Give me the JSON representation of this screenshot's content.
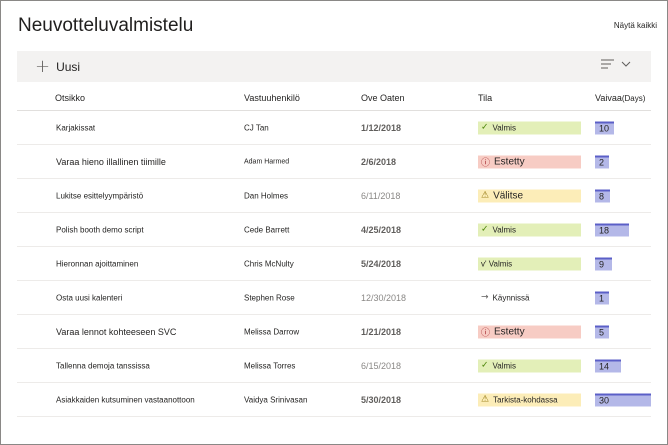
{
  "app": {
    "title": "Neuvotteluvalmistelu",
    "see_all": "Näytä kaikki"
  },
  "toolbar": {
    "new_label": "Uusi",
    "new_icon": "plus-icon",
    "view_icon": "view-options-icon"
  },
  "columns": {
    "title": "Otsikko",
    "owner": "Vastuuhenkilö",
    "due": "Ove Oaten",
    "status": "Tila",
    "effort": "Vaivaa",
    "effort_unit": "(Days)"
  },
  "status_colors": {
    "done": "#e3efb8",
    "blocked": "#f7ccc4",
    "review": "#fcedb8",
    "in_progress": "#ffffff"
  },
  "effort_max_days": 30,
  "rows": [
    {
      "title": "Karjakissat",
      "owner": "CJ Tan",
      "due": "1/12/2018",
      "status": "Valmis",
      "status_icon": "✓",
      "status_kind": "done",
      "effort": "10",
      "effort_days": 10
    },
    {
      "title": "Varaa hieno illallinen tiimille",
      "owner": "Adam Harmed",
      "due": "2/6/2018",
      "status": "Estetty",
      "status_icon": "ⓘ",
      "status_kind": "blocked",
      "effort": "2",
      "effort_days": 2
    },
    {
      "title": "Lukitse esittelyympäristö",
      "owner": "Dan Holmes",
      "due": "6/11/2018",
      "status": "Välitse",
      "status_icon": "⚠",
      "status_kind": "review",
      "effort": "8",
      "effort_days": 8
    },
    {
      "title": "Polish booth demo script",
      "owner": "Cede Barrett",
      "due": "4/25/2018",
      "status": "Valmis",
      "status_icon": "✓",
      "status_kind": "done",
      "effort": "18",
      "effort_days": 18
    },
    {
      "title": "Hieronnan ajoittaminen",
      "owner": "Chris McNulty",
      "due": "5/24/2018",
      "status": "v' Valmis",
      "status_icon": "",
      "status_kind": "done",
      "effort": "9",
      "effort_days": 9
    },
    {
      "title": "Osta uusi kalenteri",
      "owner": "Stephen Rose",
      "due": "12/30/2018",
      "status": "Käynnissä",
      "status_icon": "→",
      "status_kind": "in_progress",
      "effort": "1",
      "effort_days": 1
    },
    {
      "title": "Varaa lennot kohteeseen SVC",
      "owner": "Melissa Darrow",
      "due": "1/21/2018",
      "status": "Estetty",
      "status_icon": "ⓘ",
      "status_kind": "blocked",
      "effort": "5",
      "effort_days": 5
    },
    {
      "title": "Tallenna demoja tanssissa",
      "owner": "Melissa Torres",
      "due": "6/15/2018",
      "status": "Valmis",
      "status_icon": "✓",
      "status_kind": "done",
      "effort": "14",
      "effort_days": 14
    },
    {
      "title": "Asiakkaiden kutsuminen vastaanottoon",
      "owner": "Vaidya Srinivasan",
      "due": "5/30/2018",
      "status": "Tarkista-kohdassa",
      "status_icon": "⚠",
      "status_kind": "review",
      "effort": "30",
      "effort_days": 30
    }
  ]
}
